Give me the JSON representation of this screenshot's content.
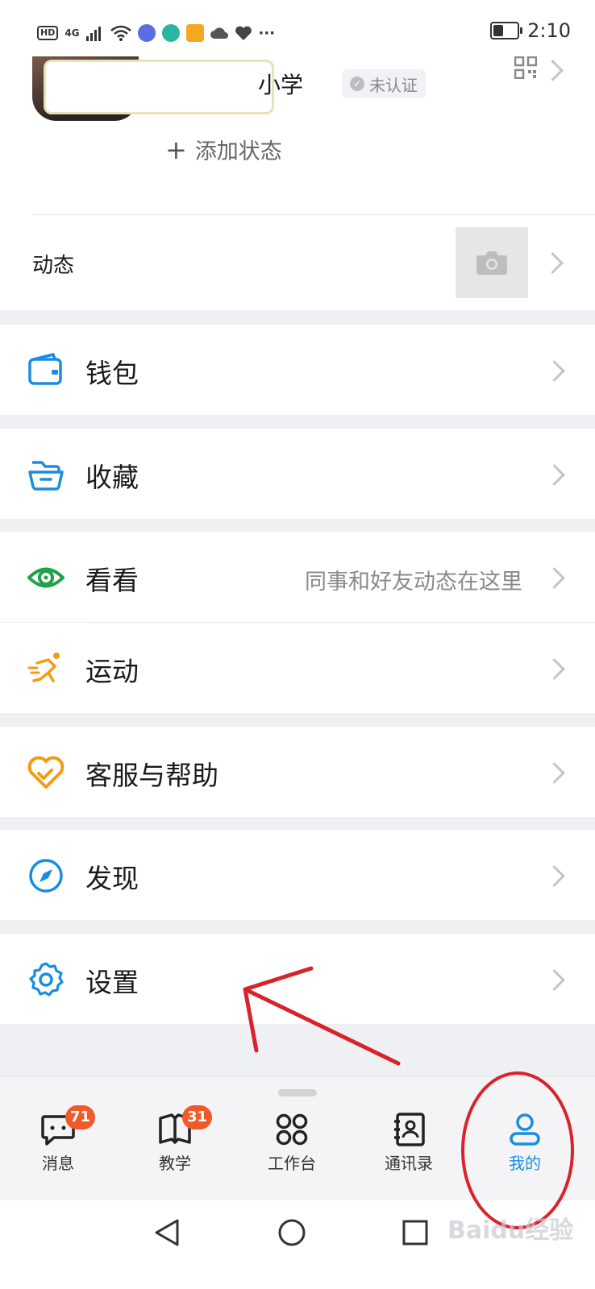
{
  "status_bar": {
    "network": "4G",
    "hd": "HD",
    "more": "···",
    "time": "2:10"
  },
  "profile": {
    "name_visible": "小学",
    "badge": "未认证",
    "add_status": "添加状态"
  },
  "dynamic": {
    "label": "动态"
  },
  "menu": [
    {
      "label": "钱包",
      "icon": "wallet-icon",
      "color": "#1a8de0"
    },
    {
      "label": "收藏",
      "icon": "folder-icon",
      "color": "#1a8de0"
    },
    {
      "label": "看看",
      "icon": "eye-icon",
      "color": "#1fa14a",
      "subtitle": "同事和好友动态在这里"
    },
    {
      "label": "运动",
      "icon": "running-icon",
      "color": "#f39c12"
    },
    {
      "label": "客服与帮助",
      "icon": "heart-icon",
      "color": "#f39c12"
    },
    {
      "label": "发现",
      "icon": "compass-icon",
      "color": "#1a8de0"
    },
    {
      "label": "设置",
      "icon": "gear-icon",
      "color": "#1a8de0"
    }
  ],
  "tabs": [
    {
      "label": "消息",
      "badge": "71"
    },
    {
      "label": "教学",
      "badge": "31"
    },
    {
      "label": "工作台"
    },
    {
      "label": "通讯录"
    },
    {
      "label": "我的",
      "active": true
    }
  ],
  "watermark": "Baidu经验",
  "colors": {
    "accent": "#1a8de0",
    "badge": "#f05a28",
    "annotation": "#d8232a"
  }
}
